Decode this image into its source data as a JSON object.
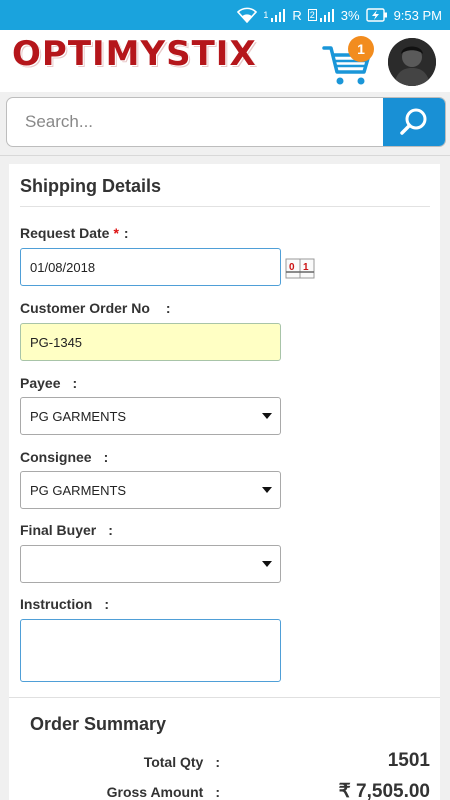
{
  "status_bar": {
    "sim1": "1",
    "sim2": "2",
    "roaming": "R",
    "battery": "3%",
    "time": "9:53 PM"
  },
  "header": {
    "logo": "OPTIMYSTIX",
    "cart_count": "1"
  },
  "search": {
    "placeholder": "Search..."
  },
  "shipping": {
    "title": "Shipping Details",
    "request_date": {
      "label": "Request Date",
      "required_mark": "*",
      "colon": ":",
      "value": "01/08/2018"
    },
    "customer_order": {
      "label": "Customer Order No",
      "colon": ":",
      "value": "PG-1345"
    },
    "payee": {
      "label": "Payee",
      "colon": ":",
      "value": "PG GARMENTS"
    },
    "consignee": {
      "label": "Consignee",
      "colon": ":",
      "value": "PG GARMENTS"
    },
    "final_buyer": {
      "label": "Final Buyer",
      "colon": ":",
      "value": ""
    },
    "instruction": {
      "label": "Instruction",
      "colon": ":",
      "value": ""
    }
  },
  "summary": {
    "title": "Order Summary",
    "total_qty": {
      "label": "Total Qty",
      "colon": ":",
      "value": "1501"
    },
    "gross_amount": {
      "label": "Gross Amount",
      "colon": ":",
      "value": "₹ 7,505.00"
    }
  },
  "colors": {
    "status_bar": "#1aa3dd",
    "brand_red": "#b5161b",
    "accent_blue": "#1990d5",
    "badge_orange": "#f28c1e",
    "highlight_yellow": "#ffffc4"
  }
}
